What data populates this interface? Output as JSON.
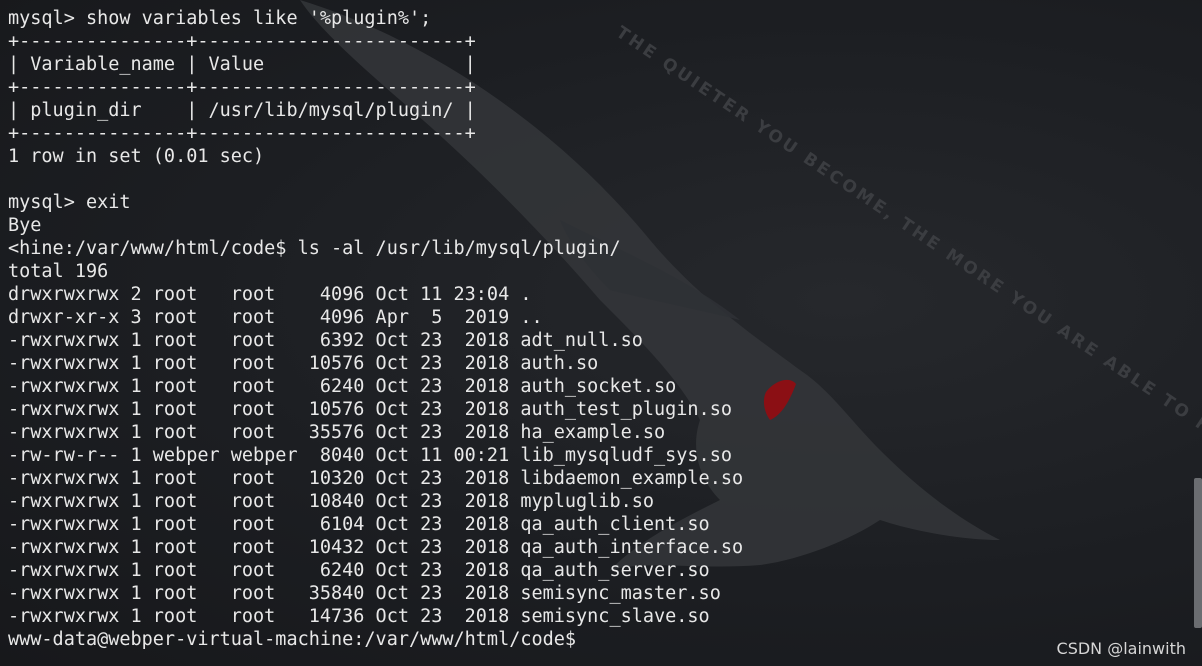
{
  "terminal": {
    "lines": [
      "mysql> show variables like '%plugin%';",
      "+---------------+------------------------+",
      "| Variable_name | Value                  |",
      "+---------------+------------------------+",
      "| plugin_dir    | /usr/lib/mysql/plugin/ |",
      "+---------------+------------------------+",
      "1 row in set (0.01 sec)",
      "",
      "mysql> exit",
      "Bye",
      "<hine:/var/www/html/code$ ls -al /usr/lib/mysql/plugin/",
      "total 196",
      "drwxrwxrwx 2 root   root    4096 Oct 11 23:04 .",
      "drwxr-xr-x 3 root   root    4096 Apr  5  2019 ..",
      "-rwxrwxrwx 1 root   root    6392 Oct 23  2018 adt_null.so",
      "-rwxrwxrwx 1 root   root   10576 Oct 23  2018 auth.so",
      "-rwxrwxrwx 1 root   root    6240 Oct 23  2018 auth_socket.so",
      "-rwxrwxrwx 1 root   root   10576 Oct 23  2018 auth_test_plugin.so",
      "-rwxrwxrwx 1 root   root   35576 Oct 23  2018 ha_example.so",
      "-rw-rw-r-- 1 webper webper  8040 Oct 11 00:21 lib_mysqludf_sys.so",
      "-rwxrwxrwx 1 root   root   10320 Oct 23  2018 libdaemon_example.so",
      "-rwxrwxrwx 1 root   root   10840 Oct 23  2018 mypluglib.so",
      "-rwxrwxrwx 1 root   root    6104 Oct 23  2018 qa_auth_client.so",
      "-rwxrwxrwx 1 root   root   10432 Oct 23  2018 qa_auth_interface.so",
      "-rwxrwxrwx 1 root   root    6240 Oct 23  2018 qa_auth_server.so",
      "-rwxrwxrwx 1 root   root   35840 Oct 23  2018 semisync_master.so",
      "-rwxrwxrwx 1 root   root   14736 Oct 23  2018 semisync_slave.so",
      "www-data@webper-virtual-machine:/var/www/html/code$"
    ]
  },
  "background_text": "THE QUIETER YOU BECOME, THE MORE YOU ARE ABLE TO HEAR",
  "watermark": "CSDN @lainwith",
  "colors": {
    "background": "#1b1d21",
    "text": "#e8e8e8",
    "dragon": "#3a3c40",
    "eye": "#8b0f14"
  },
  "icons": {
    "background_logo": "kali-dragon-icon"
  }
}
